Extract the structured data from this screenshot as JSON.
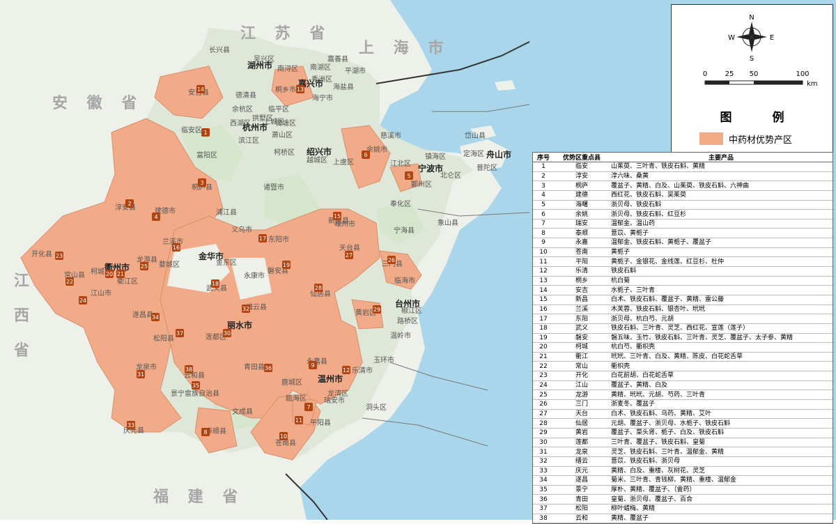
{
  "provinces": [
    {
      "name": "江 苏 省"
    },
    {
      "name": "上 海 市"
    },
    {
      "name": "安 徽 省"
    },
    {
      "name": "江 西 省"
    },
    {
      "name": "福 建 省"
    }
  ],
  "cities": [
    "湖州市",
    "嘉兴市",
    "杭州市",
    "绍兴市",
    "宁波市",
    "舟山市",
    "金华市",
    "台州市",
    "丽水市",
    "温州市",
    "衢州市"
  ],
  "places": [
    "长兴县",
    "嘉善县",
    "南湖区",
    "平湖市",
    "海盐县",
    "海宁市",
    "桐乡市",
    "德清县",
    "余杭区",
    "滨江区",
    "萧山区",
    "柯桥区",
    "越城区",
    "上虞区",
    "富阳区",
    "诸暨市",
    "慈溪市",
    "余姚市",
    "镇海区",
    "江北区",
    "北仑区",
    "鄞州区",
    "奉化区",
    "宁海县",
    "象山县",
    "岱山县",
    "定海区",
    "普陀区",
    "浦江县",
    "义乌市",
    "东阳市",
    "嵊州市",
    "新昌县",
    "天台县",
    "三门县",
    "临海市",
    "椒江区",
    "路桥区",
    "温岭市",
    "黄岩区",
    "仙居县",
    "磐安县",
    "永康市",
    "武义县",
    "缙云县",
    "青田县",
    "永嘉县",
    "乐清市",
    "鹿城区",
    "瓯海区",
    "龙湾区",
    "玉环市",
    "瑞安市",
    "洞头区",
    "平阳县",
    "苍南县",
    "文成县",
    "泰顺县",
    "景宁畲族自治县",
    "云和县",
    "龙泉市",
    "庆元县",
    "松阳县",
    "遂昌县",
    "莲都区",
    "兰溪市",
    "婺城区",
    "金东区",
    "龙游县",
    "衢江区",
    "柯城区",
    "常山县",
    "江山市",
    "开化县",
    "建德市",
    "淳安县",
    "桐庐县",
    "临安区",
    "安吉县",
    "吴兴区",
    "南浔区",
    "秀洲区",
    "西湖区",
    "上城区",
    "拱墅区",
    "钱塘区",
    "临平区"
  ],
  "compass": {
    "n": "N",
    "s": "S",
    "e": "E",
    "w": "W"
  },
  "scale": {
    "ticks": [
      "0",
      "25",
      "50",
      "100"
    ],
    "unit": "km"
  },
  "legend": {
    "title": "图 例",
    "label": "中药材优势产区",
    "color": "#f3aa86"
  },
  "table": {
    "headers": [
      "序号",
      "优势区重点县",
      "主要产品"
    ],
    "rows": [
      [
        "1",
        "临安",
        "山茱萸、三叶青、铁皮石斛、黄精"
      ],
      [
        "2",
        "淳安",
        "淳六味、桑黄"
      ],
      [
        "3",
        "桐庐",
        "覆盆子、黄精、白及、山茱萸、铁皮石斛、六神曲"
      ],
      [
        "4",
        "建德",
        "西红花、铁皮石斛、吴茱萸"
      ],
      [
        "5",
        "海曙",
        "浙贝母、铁皮石斛"
      ],
      [
        "6",
        "余姚",
        "浙贝母、铁皮石斛、红豆杉"
      ],
      [
        "7",
        "瑞安",
        "温郁金、温山药"
      ],
      [
        "8",
        "泰顺",
        "薏苡、黄栀子"
      ],
      [
        "9",
        "永嘉",
        "温郁金、铁皮石斛、黄栀子、覆盆子"
      ],
      [
        "10",
        "苍南",
        "黄栀子"
      ],
      [
        "11",
        "平阳",
        "黄栀子、金银花、金线莲、红豆杉、杜仲"
      ],
      [
        "12",
        "乐清",
        "铁皮石斛"
      ],
      [
        "13",
        "桐乡",
        "杭白菊"
      ],
      [
        "14",
        "安吉",
        "水栀子、三叶青"
      ],
      [
        "15",
        "新昌",
        "白术、铁皮石斛、覆盆子、黄精、雷公藤"
      ],
      [
        "16",
        "兰溪",
        "木芙蓉、铁皮石斛、银杏叶、玳玳"
      ],
      [
        "17",
        "东阳",
        "浙贝母、杭白芍、元胡"
      ],
      [
        "18",
        "武义",
        "铁皮石斛、三叶青、灵芝、西红花、宣莲（莲子）"
      ],
      [
        "19",
        "磐安",
        "磐五味、玉竹、铁皮石斛、三叶青、灵芝、覆盆子、太子参、黄精"
      ],
      [
        "20",
        "柯城",
        "杭白芍、衢枳壳"
      ],
      [
        "21",
        "衢江",
        "玳玳、三叶青、白及、黄精、陈皮、白花蛇舌草"
      ],
      [
        "22",
        "常山",
        "衢枳壳"
      ],
      [
        "23",
        "开化",
        "白花前胡、白花蛇舌草"
      ],
      [
        "24",
        "江山",
        "覆盆子、黄精、白及"
      ],
      [
        "25",
        "龙游",
        "黄精、玳玳、元胡、芍药、三叶青"
      ],
      [
        "26",
        "三门",
        "浙麦冬、覆盆子"
      ],
      [
        "27",
        "天台",
        "白术、铁皮石斛、乌药、黄精、艾叶"
      ],
      [
        "28",
        "仙居",
        "元胡、覆盆子、浙贝母、水栀子、铁皮石斛"
      ],
      [
        "29",
        "黄岩",
        "覆盆子、菜头肾、栀子、白及、铁皮石斛"
      ],
      [
        "30",
        "莲都",
        "三叶青、覆盆子、铁皮石斛、皇菊"
      ],
      [
        "31",
        "龙泉",
        "灵芝、铁皮石斛、三叶青、温郁金、黄精"
      ],
      [
        "32",
        "缙云",
        "薏苡、铁皮石斛、浙贝母"
      ],
      [
        "33",
        "庆元",
        "黄精、白及、重楼、灰树花、灵芝"
      ],
      [
        "34",
        "遂昌",
        "菊米、三叶青、青钱柳、黄精、重楼、温郁金"
      ],
      [
        "35",
        "景宁",
        "厚朴、黄精、覆盆子、（畲药）"
      ],
      [
        "36",
        "青田",
        "皇菊、浙贝母、覆盆子、百合"
      ],
      [
        "37",
        "松阳",
        "柳叶蜡梅、黄精"
      ],
      [
        "38",
        "云和",
        "黄精、覆盆子"
      ]
    ]
  },
  "markers": [
    "1",
    "2",
    "3",
    "4",
    "5",
    "6",
    "7",
    "8",
    "9",
    "10",
    "11",
    "12",
    "13",
    "14",
    "15",
    "16",
    "17",
    "18",
    "19",
    "20",
    "21",
    "22",
    "23",
    "24",
    "25",
    "26",
    "27",
    "28",
    "29",
    "30",
    "31",
    "32",
    "33",
    "34",
    "35",
    "36",
    "37",
    "38"
  ]
}
